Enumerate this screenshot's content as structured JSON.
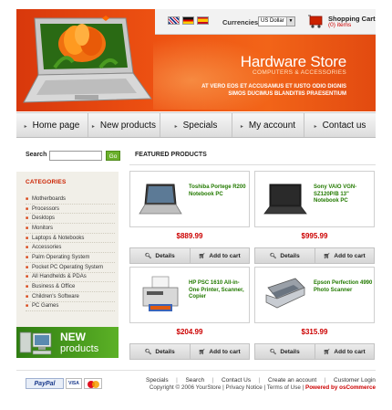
{
  "header": {
    "currencies_label": "Currencies:",
    "currency_selected": "US Dollar",
    "cart_title": "Shopping Cart",
    "cart_items": "(0) items",
    "store_title": "Hardware Store",
    "store_subtitle": "COMPUTERS & ACCESSORIES",
    "tagline_line1": "AT VERO EOS ET ACCUSAMUS ET IUSTO ODIO DIGNIS",
    "tagline_line2": "SIMOS DUCIMUS BLANDITIIS PRAESENTIUM",
    "flags": [
      "uk-flag-icon",
      "germany-flag-icon",
      "spain-flag-icon"
    ]
  },
  "nav": {
    "items": [
      "Home page",
      "New products",
      "Specials",
      "My account",
      "Contact us"
    ]
  },
  "search": {
    "label": "Search",
    "button": "Go"
  },
  "categories": {
    "title": "CATEGORIES",
    "items": [
      "Motherboards",
      "Processors",
      "Desktops",
      "Monitors",
      "Laptops & Notebooks",
      "Accessories",
      "Palm Operating System",
      "Pocket PC Operating System",
      "All Handhelds & PDAs",
      "Business & Office",
      "Children's Software",
      "PC Games"
    ]
  },
  "new_products_banner": {
    "line1": "NEW",
    "line2": "products"
  },
  "featured": {
    "title": "FEATURED PRODUCTS",
    "products": [
      {
        "name": "Toshiba Portege R200 Notebook PC",
        "price": "$889.99",
        "image": "laptop-icon"
      },
      {
        "name": "Sony VAIO VGN-SZ120P/B 13\" Notebook PC",
        "price": "$995.99",
        "image": "laptop-icon"
      },
      {
        "name": "HP PSC 1610 All-in-One Printer, Scanner, Copier",
        "price": "$204.99",
        "image": "printer-icon"
      },
      {
        "name": "Epson Perfection 4990 Photo Scanner",
        "price": "$315.99",
        "image": "scanner-icon"
      }
    ],
    "details_label": "Details",
    "add_to_cart_label": "Add to cart"
  },
  "footer": {
    "links": [
      "Specials",
      "Search",
      "Contact Us",
      "Create an account",
      "Customer Login"
    ],
    "copyright_prefix": "Copyright © 2006 YourStore | Privacy Notice | Terms of Use |",
    "powered_by": "Powered by osCommerce",
    "payments": [
      "PayPal",
      "VISA",
      "MasterCard"
    ]
  },
  "colors": {
    "header_orange": "#ee5212",
    "price_red": "#cc0000",
    "product_name_green": "#237a00",
    "go_green": "#6bb02c"
  }
}
